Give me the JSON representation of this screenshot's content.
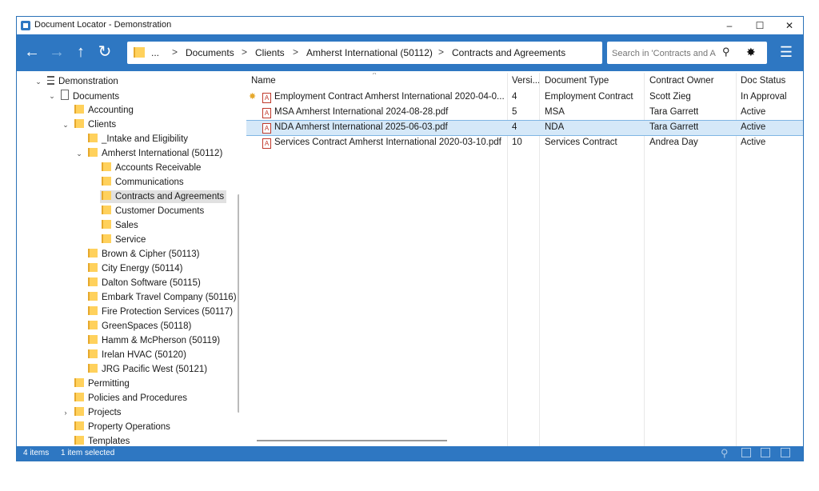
{
  "window": {
    "title": "Document Locator - Demonstration"
  },
  "window_controls": {
    "minimize": "–",
    "maximize": "☐",
    "close": "✕"
  },
  "toolbar": {
    "back": "←",
    "forward": "→",
    "up": "↑",
    "refresh": "↻",
    "menu": "☰"
  },
  "breadcrumb": {
    "ellipsis": "...",
    "sep": ">",
    "items": [
      "Documents",
      "Clients",
      "Amherst International (50112)",
      "Contracts and Agreements"
    ]
  },
  "search": {
    "placeholder": "Search in 'Contracts and A",
    "icon": "⚲",
    "settings": "✸"
  },
  "tree": {
    "items": [
      {
        "label": "Demonstration",
        "chev": "⌄"
      },
      {
        "label": "Documents",
        "chev": "⌄"
      },
      {
        "label": "Accounting"
      },
      {
        "label": "Clients",
        "chev": "⌄"
      },
      {
        "label": "_Intake and Eligibility"
      },
      {
        "label": "Amherst International (50112)",
        "chev": "⌄"
      },
      {
        "label": "Accounts Receivable"
      },
      {
        "label": "Communications"
      },
      {
        "label": "Contracts and Agreements"
      },
      {
        "label": "Customer Documents"
      },
      {
        "label": "Sales"
      },
      {
        "label": "Service"
      },
      {
        "label": "Brown & Cipher (50113)"
      },
      {
        "label": "City Energy (50114)"
      },
      {
        "label": "Dalton Software (50115)"
      },
      {
        "label": "Embark Travel Company (50116)"
      },
      {
        "label": "Fire Protection Services (50117)"
      },
      {
        "label": "GreenSpaces (50118)"
      },
      {
        "label": "Hamm & McPherson (50119)"
      },
      {
        "label": "Irelan HVAC (50120)"
      },
      {
        "label": "JRG Pacific West (50121)"
      },
      {
        "label": "Permitting"
      },
      {
        "label": "Policies and Procedures"
      },
      {
        "label": "Projects",
        "chev": "›"
      },
      {
        "label": "Property Operations"
      },
      {
        "label": "Templates"
      }
    ]
  },
  "list": {
    "sort_indicator": "^",
    "columns": [
      "Name",
      "Versi...",
      "Document Type",
      "Contract Owner",
      "Doc Status"
    ],
    "rows": [
      {
        "name": "Employment Contract Amherst International 2020-04-0...",
        "version": "4",
        "type": "Employment Contract",
        "owner": "Scott Zieg",
        "status": "In Approval"
      },
      {
        "name": "MSA Amherst International 2024-08-28.pdf",
        "version": "5",
        "type": "MSA",
        "owner": "Tara Garrett",
        "status": "Active"
      },
      {
        "name": "NDA Amherst International 2025-06-03.pdf",
        "version": "4",
        "type": "NDA",
        "owner": "Tara Garrett",
        "status": "Active"
      },
      {
        "name": "Services Contract Amherst International 2020-03-10.pdf",
        "version": "10",
        "type": "Services Contract",
        "owner": "Andrea Day",
        "status": "Active"
      }
    ]
  },
  "status": {
    "items": "4 items",
    "selected": "1 item selected"
  },
  "colors": {
    "accent": "#2e77c2",
    "selection": "#d5e8f8",
    "folder": "#ffd15c"
  }
}
